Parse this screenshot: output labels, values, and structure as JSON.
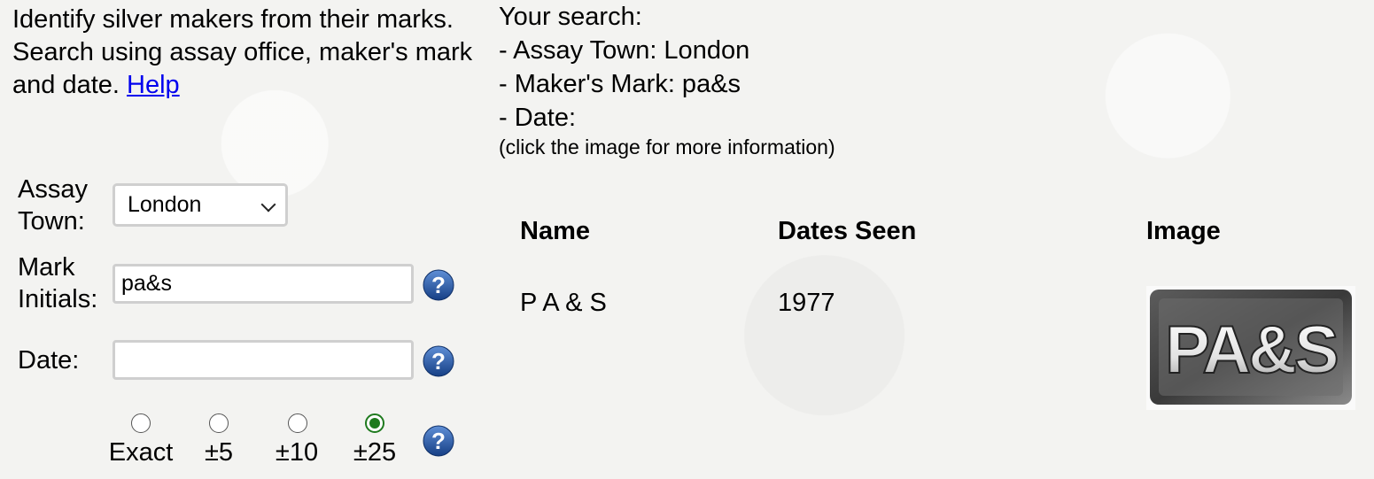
{
  "intro": {
    "text": "Identify silver makers from their marks. Search using assay office, maker's mark and date.",
    "help_link": "Help"
  },
  "summary": {
    "heading": "Your search:",
    "assay_line": "- Assay Town: London",
    "mark_line": "- Maker's Mark: pa&s",
    "date_line": "- Date:",
    "note": "(click the image for more information)"
  },
  "form": {
    "assay_label_1": "Assay",
    "assay_label_2": "Town:",
    "assay_value": "London",
    "mark_label_1": "Mark",
    "mark_label_2": "Initials:",
    "mark_value": "pa&s",
    "date_label": "Date:",
    "date_value": "",
    "range_options": [
      {
        "label": "Exact",
        "checked": false
      },
      {
        "label": "±5",
        "checked": false
      },
      {
        "label": "±10",
        "checked": false
      },
      {
        "label": "±25",
        "checked": true
      }
    ],
    "help_icon": "question-mark-icon"
  },
  "results": {
    "headers": [
      "Name",
      "Dates Seen",
      "Image"
    ],
    "rows": [
      {
        "name": "P A & S",
        "dates": "1977",
        "image_text": "PA&S"
      }
    ]
  },
  "colors": {
    "link": "#0000ee",
    "radio_checked": "#1e7a1e",
    "help_icon": "#1f4f96"
  }
}
